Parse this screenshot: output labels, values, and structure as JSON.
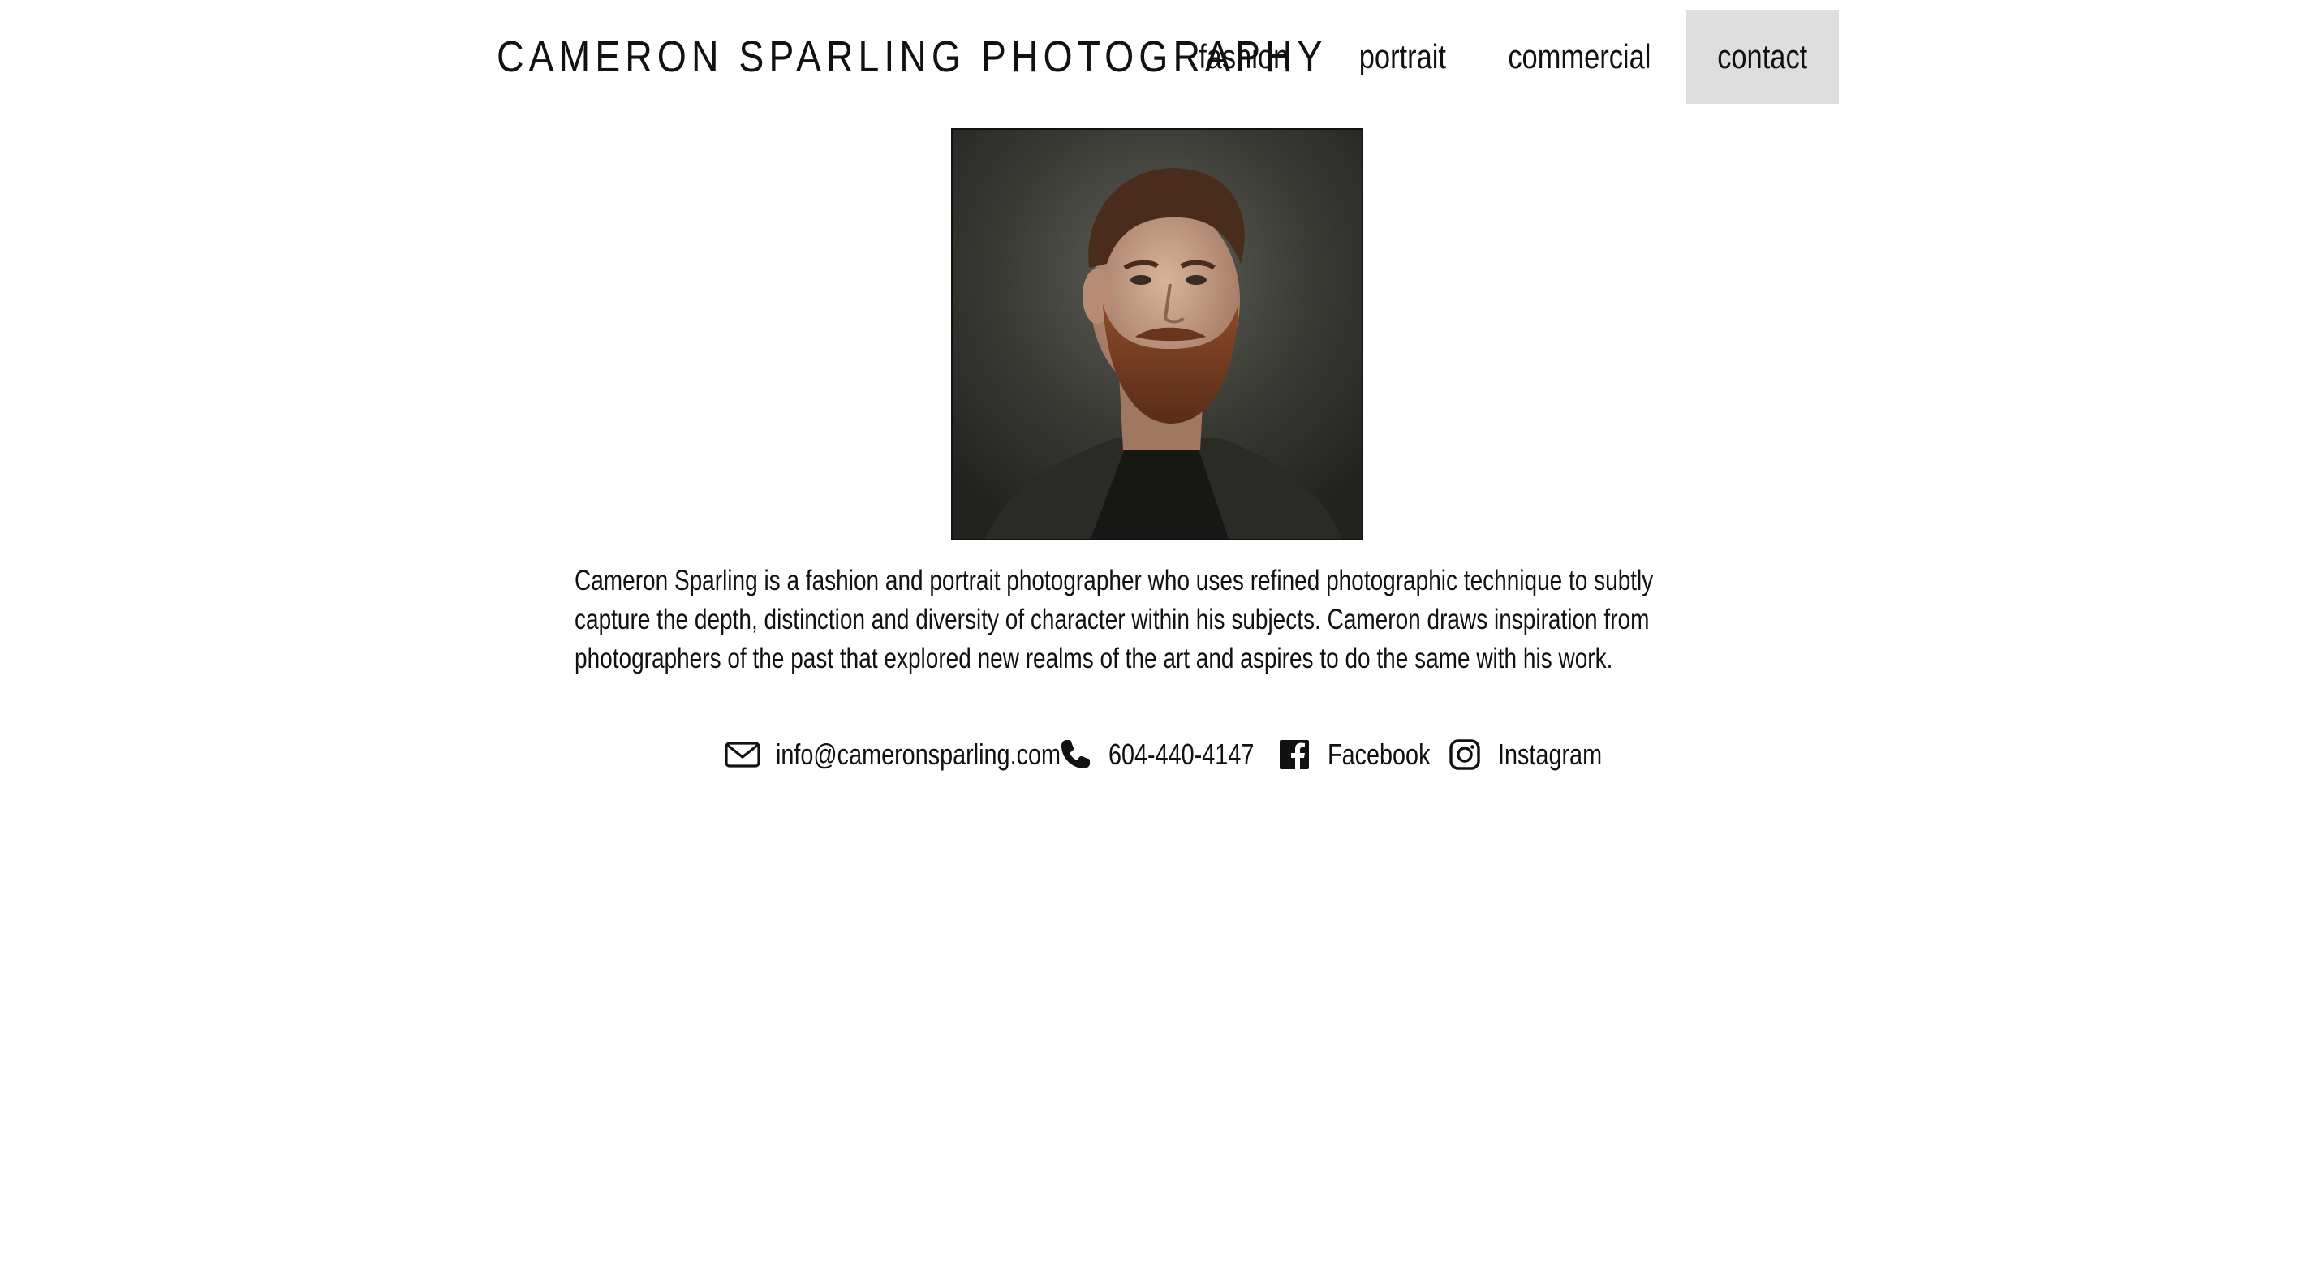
{
  "header": {
    "site_title": "CAMERON SPARLING PHOTOGRAPHY",
    "nav": [
      {
        "label": "fashion",
        "active": false
      },
      {
        "label": "portrait",
        "active": false
      },
      {
        "label": "commercial",
        "active": false
      },
      {
        "label": "contact",
        "active": true
      }
    ],
    "active_tab_color": "#dedede"
  },
  "main": {
    "bio": "Cameron Sparling is a fashion and portrait photographer who uses refined photographic technique to subtly capture the depth, distinction and diversity of character within his subjects. Cameron draws inspiration from photographers of the past that explored new realms of the art and aspires to do the same with his work."
  },
  "contacts": {
    "email": {
      "icon": "envelope-icon",
      "label": "info@cameronsparling.com"
    },
    "phone": {
      "icon": "phone-icon",
      "label": "604-440-4147"
    },
    "facebook": {
      "icon": "facebook-icon",
      "label": "Facebook"
    },
    "instagram": {
      "icon": "instagram-icon",
      "label": "Instagram"
    }
  }
}
